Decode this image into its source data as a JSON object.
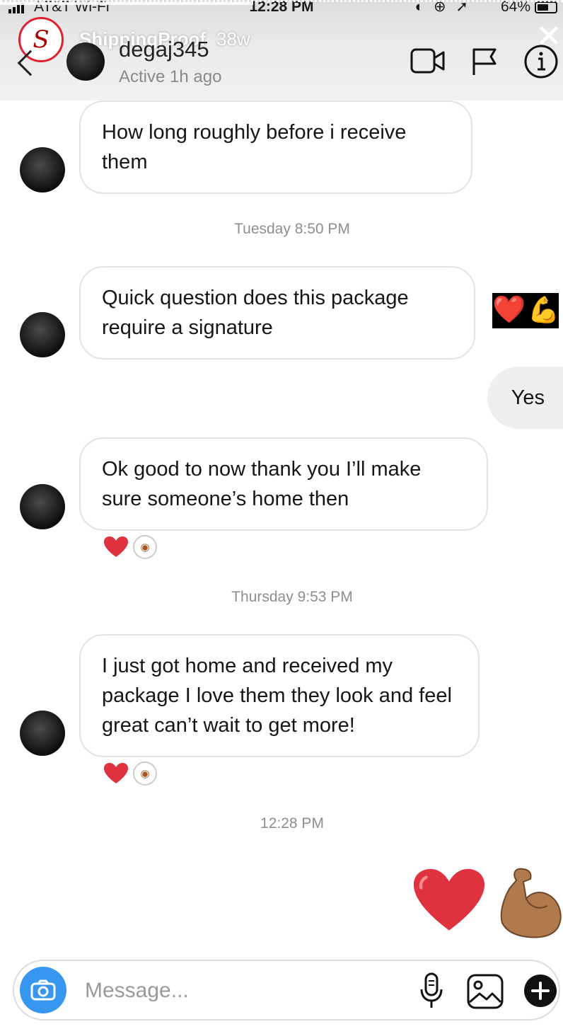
{
  "status_bar": {
    "carrier": "AT&T Wi-Fi",
    "time": "12:28 PM",
    "battery": "64%",
    "battery_level": 0.64
  },
  "story_overlay": {
    "username": "ShippingProof",
    "age": "38w",
    "progress": 0.45
  },
  "header": {
    "username": "degaj345",
    "status": "Active 1h ago",
    "icons": [
      "video-call-icon",
      "flag-icon",
      "info-icon"
    ]
  },
  "messages": [
    {
      "type": "incoming",
      "text": "How long roughly before i receive them"
    },
    {
      "type": "timestamp",
      "text": "Tuesday 8:50 PM"
    },
    {
      "type": "incoming",
      "text": "Quick question does this package require a signature"
    },
    {
      "type": "outgoing",
      "text": "Yes"
    },
    {
      "type": "incoming",
      "text": "Ok good to now thank you I’ll make sure someone’s home then"
    },
    {
      "type": "timestamp",
      "text": "Thursday 9:53 PM"
    },
    {
      "type": "incoming",
      "text": "I just got home and received my package I love them they look and feel great can’t wait to get more!"
    },
    {
      "type": "timestamp",
      "text": "12:28 PM"
    }
  ],
  "reactions": {
    "story_react_emojis": [
      "❤️",
      "💪"
    ],
    "big_emojis": [
      "❤️",
      "💪"
    ]
  },
  "composer": {
    "placeholder": "Message...",
    "icons": [
      "camera-icon",
      "microphone-icon",
      "gallery-icon",
      "plus-icon"
    ]
  },
  "colors": {
    "accent_blue": "#3797f0",
    "heart_red": "#e0323e",
    "incoming_bubble_border": "#e3e3e3",
    "outgoing_bubble": "#efefef"
  }
}
